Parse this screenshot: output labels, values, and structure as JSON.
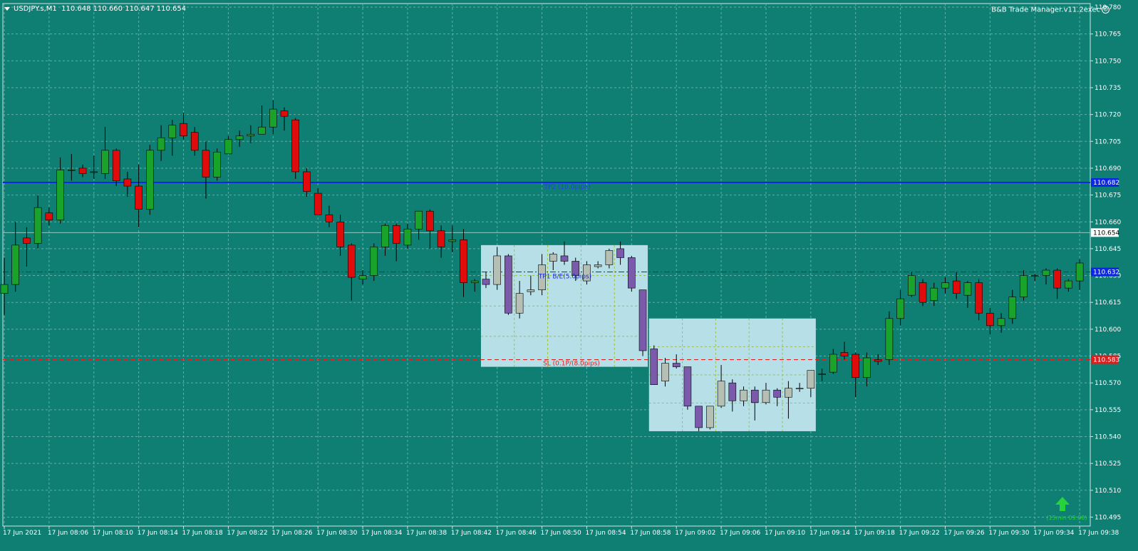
{
  "header": {
    "symbol": "USDJPY.s,M1",
    "ohlc": "110.648 110.660 110.647 110.654"
  },
  "expert_label": "B&B Trade Manager.v11.2exec",
  "colors": {
    "background": "#0f7f74",
    "grid": "#5fb0a8",
    "bull": "#1aa32b",
    "bear": "#e00b0b",
    "tp2_line": "#0a26e6",
    "tp1_line": "#1a2ad0",
    "sl_line": "#e01c1c",
    "zone_fill": "#b7dfe8",
    "zone_candle_bull": "#b5bfb4",
    "zone_candle_bear": "#7c5aab",
    "arrow": "#27d23a"
  },
  "price_axis": {
    "ticks": [
      "110.780",
      "110.765",
      "110.750",
      "110.735",
      "110.720",
      "110.705",
      "110.690",
      "110.675",
      "110.660",
      "110.645",
      "110.630",
      "110.615",
      "110.600",
      "110.585",
      "110.570",
      "110.555",
      "110.540",
      "110.525",
      "110.510",
      "110.495"
    ],
    "highlight_labels": [
      {
        "text": "110.682",
        "price": 110.682,
        "bg": "#0a26e6",
        "fg": "#ffffff"
      },
      {
        "text": "110.654",
        "price": 110.654,
        "bg": "#ffffff",
        "fg": "#000000"
      },
      {
        "text": "110.632",
        "price": 110.632,
        "bg": "#0a26e6",
        "fg": "#ffffff"
      },
      {
        "text": "110.583",
        "price": 110.583,
        "bg": "#e01c1c",
        "fg": "#ffffff"
      }
    ]
  },
  "time_axis": {
    "ticks": [
      "17 Jun 2021",
      "17 Jun 08:06",
      "17 Jun 08:10",
      "17 Jun 08:14",
      "17 Jun 08:18",
      "17 Jun 08:22",
      "17 Jun 08:26",
      "17 Jun 08:30",
      "17 Jun 08:34",
      "17 Jun 08:38",
      "17 Jun 08:42",
      "17 Jun 08:46",
      "17 Jun 08:50",
      "17 Jun 08:54",
      "17 Jun 08:58",
      "17 Jun 09:02",
      "17 Jun 09:06",
      "17 Jun 09:10",
      "17 Jun 09:14",
      "17 Jun 09:18",
      "17 Jun 09:22",
      "17 Jun 09:26",
      "17 Jun 09:30",
      "17 Jun 09:34",
      "17 Jun 09:38"
    ]
  },
  "levels": {
    "tp2": {
      "price": 110.682,
      "label": "TP2 (10.0pips)"
    },
    "tp1": {
      "price": 110.632,
      "label": "TP1 B/E(5.0pips)"
    },
    "sl": {
      "price": 110.583,
      "label": "SL (0.1P/(8.0pips)"
    },
    "bid": {
      "price": 110.654
    }
  },
  "zones": [
    {
      "start_bar": 43,
      "end_bar": 57,
      "top": 110.647,
      "bottom": 110.579
    },
    {
      "start_bar": 58,
      "end_bar": 72,
      "top": 110.606,
      "bottom": 110.543
    }
  ],
  "arrow_label": "(15min 09:08)",
  "chart_data": {
    "type": "candlestick",
    "symbol": "USDJPY.s",
    "timeframe": "M1",
    "ylim": [
      110.49,
      110.782
    ],
    "bars": [
      {
        "o": 110.62,
        "h": 110.64,
        "l": 110.608,
        "c": 110.625
      },
      {
        "o": 110.625,
        "h": 110.66,
        "l": 110.621,
        "c": 110.647
      },
      {
        "o": 110.651,
        "h": 110.657,
        "l": 110.635,
        "c": 110.648
      },
      {
        "o": 110.648,
        "h": 110.675,
        "l": 110.645,
        "c": 110.668
      },
      {
        "o": 110.665,
        "h": 110.668,
        "l": 110.658,
        "c": 110.661
      },
      {
        "o": 110.661,
        "h": 110.696,
        "l": 110.659,
        "c": 110.689
      },
      {
        "o": 110.689,
        "h": 110.698,
        "l": 110.683,
        "c": 110.689
      },
      {
        "o": 110.69,
        "h": 110.692,
        "l": 110.685,
        "c": 110.687
      },
      {
        "o": 110.688,
        "h": 110.697,
        "l": 110.684,
        "c": 110.688
      },
      {
        "o": 110.687,
        "h": 110.713,
        "l": 110.684,
        "c": 110.7
      },
      {
        "o": 110.7,
        "h": 110.701,
        "l": 110.68,
        "c": 110.683
      },
      {
        "o": 110.684,
        "h": 110.688,
        "l": 110.674,
        "c": 110.68
      },
      {
        "o": 110.68,
        "h": 110.692,
        "l": 110.657,
        "c": 110.667
      },
      {
        "o": 110.667,
        "h": 110.703,
        "l": 110.664,
        "c": 110.7
      },
      {
        "o": 110.7,
        "h": 110.714,
        "l": 110.694,
        "c": 110.707
      },
      {
        "o": 110.707,
        "h": 110.717,
        "l": 110.697,
        "c": 110.714
      },
      {
        "o": 110.715,
        "h": 110.721,
        "l": 110.706,
        "c": 110.708
      },
      {
        "o": 110.71,
        "h": 110.713,
        "l": 110.697,
        "c": 110.7
      },
      {
        "o": 110.7,
        "h": 110.705,
        "l": 110.673,
        "c": 110.685
      },
      {
        "o": 110.685,
        "h": 110.701,
        "l": 110.683,
        "c": 110.699
      },
      {
        "o": 110.698,
        "h": 110.708,
        "l": 110.698,
        "c": 110.706
      },
      {
        "o": 110.706,
        "h": 110.711,
        "l": 110.702,
        "c": 110.708
      },
      {
        "o": 110.708,
        "h": 110.714,
        "l": 110.704,
        "c": 110.709
      },
      {
        "o": 110.709,
        "h": 110.725,
        "l": 110.709,
        "c": 110.713
      },
      {
        "o": 110.713,
        "h": 110.728,
        "l": 110.709,
        "c": 110.723
      },
      {
        "o": 110.722,
        "h": 110.724,
        "l": 110.711,
        "c": 110.719
      },
      {
        "o": 110.717,
        "h": 110.718,
        "l": 110.684,
        "c": 110.688
      },
      {
        "o": 110.688,
        "h": 110.69,
        "l": 110.674,
        "c": 110.677
      },
      {
        "o": 110.676,
        "h": 110.679,
        "l": 110.664,
        "c": 110.664
      },
      {
        "o": 110.664,
        "h": 110.669,
        "l": 110.657,
        "c": 110.66
      },
      {
        "o": 110.66,
        "h": 110.664,
        "l": 110.641,
        "c": 110.646
      },
      {
        "o": 110.647,
        "h": 110.648,
        "l": 110.616,
        "c": 110.629
      },
      {
        "o": 110.628,
        "h": 110.633,
        "l": 110.625,
        "c": 110.63
      },
      {
        "o": 110.63,
        "h": 110.648,
        "l": 110.627,
        "c": 110.646
      },
      {
        "o": 110.646,
        "h": 110.659,
        "l": 110.641,
        "c": 110.658
      },
      {
        "o": 110.658,
        "h": 110.659,
        "l": 110.638,
        "c": 110.648
      },
      {
        "o": 110.647,
        "h": 110.659,
        "l": 110.645,
        "c": 110.656
      },
      {
        "o": 110.656,
        "h": 110.666,
        "l": 110.65,
        "c": 110.666
      },
      {
        "o": 110.666,
        "h": 110.667,
        "l": 110.645,
        "c": 110.655
      },
      {
        "o": 110.655,
        "h": 110.658,
        "l": 110.64,
        "c": 110.646
      },
      {
        "o": 110.649,
        "h": 110.658,
        "l": 110.643,
        "c": 110.65
      },
      {
        "o": 110.65,
        "h": 110.656,
        "l": 110.618,
        "c": 110.626
      },
      {
        "o": 110.626,
        "h": 110.628,
        "l": 110.621,
        "c": 110.627
      },
      {
        "o": 110.628,
        "h": 110.632,
        "l": 110.623,
        "c": 110.625
      },
      {
        "o": 110.625,
        "h": 110.646,
        "l": 110.622,
        "c": 110.641
      },
      {
        "o": 110.641,
        "h": 110.642,
        "l": 110.608,
        "c": 110.609
      },
      {
        "o": 110.609,
        "h": 110.627,
        "l": 110.606,
        "c": 110.62
      },
      {
        "o": 110.621,
        "h": 110.63,
        "l": 110.619,
        "c": 110.622
      },
      {
        "o": 110.622,
        "h": 110.642,
        "l": 110.619,
        "c": 110.636
      },
      {
        "o": 110.638,
        "h": 110.643,
        "l": 110.633,
        "c": 110.642
      },
      {
        "o": 110.641,
        "h": 110.649,
        "l": 110.636,
        "c": 110.638
      },
      {
        "o": 110.638,
        "h": 110.64,
        "l": 110.627,
        "c": 110.63
      },
      {
        "o": 110.627,
        "h": 110.638,
        "l": 110.625,
        "c": 110.636
      },
      {
        "o": 110.635,
        "h": 110.638,
        "l": 110.634,
        "c": 110.636
      },
      {
        "o": 110.636,
        "h": 110.645,
        "l": 110.634,
        "c": 110.644
      },
      {
        "o": 110.645,
        "h": 110.649,
        "l": 110.636,
        "c": 110.64
      },
      {
        "o": 110.64,
        "h": 110.641,
        "l": 110.621,
        "c": 110.623
      },
      {
        "o": 110.622,
        "h": 110.622,
        "l": 110.585,
        "c": 110.588
      },
      {
        "o": 110.589,
        "h": 110.591,
        "l": 110.569,
        "c": 110.569
      },
      {
        "o": 110.571,
        "h": 110.584,
        "l": 110.568,
        "c": 110.581
      },
      {
        "o": 110.581,
        "h": 110.586,
        "l": 110.578,
        "c": 110.579
      },
      {
        "o": 110.579,
        "h": 110.579,
        "l": 110.555,
        "c": 110.557
      },
      {
        "o": 110.557,
        "h": 110.557,
        "l": 110.543,
        "c": 110.545
      },
      {
        "o": 110.545,
        "h": 110.557,
        "l": 110.544,
        "c": 110.557
      },
      {
        "o": 110.557,
        "h": 110.58,
        "l": 110.556,
        "c": 110.571
      },
      {
        "o": 110.57,
        "h": 110.572,
        "l": 110.554,
        "c": 110.56
      },
      {
        "o": 110.56,
        "h": 110.568,
        "l": 110.557,
        "c": 110.566
      },
      {
        "o": 110.566,
        "h": 110.568,
        "l": 110.549,
        "c": 110.559
      },
      {
        "o": 110.559,
        "h": 110.57,
        "l": 110.558,
        "c": 110.566
      },
      {
        "o": 110.566,
        "h": 110.567,
        "l": 110.557,
        "c": 110.562
      },
      {
        "o": 110.562,
        "h": 110.571,
        "l": 110.55,
        "c": 110.567
      },
      {
        "o": 110.567,
        "h": 110.57,
        "l": 110.565,
        "c": 110.567
      },
      {
        "o": 110.567,
        "h": 110.577,
        "l": 110.562,
        "c": 110.577
      },
      {
        "o": 110.575,
        "h": 110.578,
        "l": 110.571,
        "c": 110.575
      },
      {
        "o": 110.576,
        "h": 110.589,
        "l": 110.575,
        "c": 110.586
      },
      {
        "o": 110.587,
        "h": 110.593,
        "l": 110.583,
        "c": 110.585
      },
      {
        "o": 110.586,
        "h": 110.587,
        "l": 110.562,
        "c": 110.573
      },
      {
        "o": 110.573,
        "h": 110.587,
        "l": 110.568,
        "c": 110.584
      },
      {
        "o": 110.583,
        "h": 110.586,
        "l": 110.58,
        "c": 110.582
      },
      {
        "o": 110.583,
        "h": 110.61,
        "l": 110.58,
        "c": 110.606
      },
      {
        "o": 110.606,
        "h": 110.622,
        "l": 110.602,
        "c": 110.617
      },
      {
        "o": 110.619,
        "h": 110.632,
        "l": 110.618,
        "c": 110.63
      },
      {
        "o": 110.626,
        "h": 110.628,
        "l": 110.613,
        "c": 110.615
      },
      {
        "o": 110.616,
        "h": 110.626,
        "l": 110.613,
        "c": 110.623
      },
      {
        "o": 110.623,
        "h": 110.629,
        "l": 110.62,
        "c": 110.626
      },
      {
        "o": 110.627,
        "h": 110.632,
        "l": 110.617,
        "c": 110.62
      },
      {
        "o": 110.619,
        "h": 110.627,
        "l": 110.612,
        "c": 110.626
      },
      {
        "o": 110.626,
        "h": 110.628,
        "l": 110.605,
        "c": 110.609
      },
      {
        "o": 110.609,
        "h": 110.612,
        "l": 110.597,
        "c": 110.602
      },
      {
        "o": 110.602,
        "h": 110.609,
        "l": 110.598,
        "c": 110.606
      },
      {
        "o": 110.606,
        "h": 110.622,
        "l": 110.603,
        "c": 110.618
      },
      {
        "o": 110.618,
        "h": 110.633,
        "l": 110.616,
        "c": 110.63
      },
      {
        "o": 110.63,
        "h": 110.631,
        "l": 110.627,
        "c": 110.63
      },
      {
        "o": 110.63,
        "h": 110.634,
        "l": 110.625,
        "c": 110.633
      },
      {
        "o": 110.633,
        "h": 110.634,
        "l": 110.617,
        "c": 110.623
      },
      {
        "o": 110.623,
        "h": 110.628,
        "l": 110.621,
        "c": 110.627
      },
      {
        "o": 110.627,
        "h": 110.639,
        "l": 110.622,
        "c": 110.637
      }
    ]
  }
}
